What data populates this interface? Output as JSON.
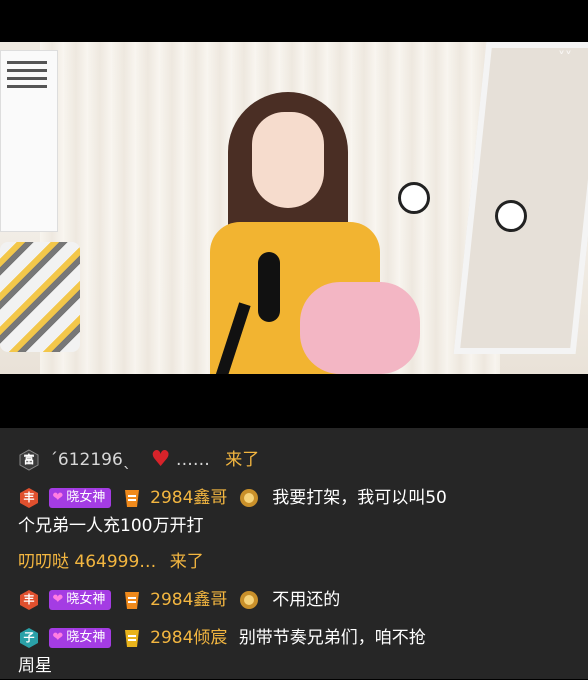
{
  "stream": {
    "collapse_label": "˅˅"
  },
  "chat": {
    "messages": [
      {
        "type": "arrival",
        "level_badge": "富",
        "user": "´612196ˎ",
        "user_suffix": "……",
        "arrive_text": "来了"
      },
      {
        "type": "chat",
        "level_badge": "丰",
        "guard_label": "晓女神",
        "fan_name": "2984鑫哥",
        "line1": "我要打架，我可以叫50",
        "line2": "个兄弟一人充100万开打"
      },
      {
        "type": "arrival",
        "user": "叨叨哒 464999…",
        "arrive_text": "来了"
      },
      {
        "type": "chat",
        "level_badge": "丰",
        "guard_label": "晓女神",
        "fan_name": "2984鑫哥",
        "line1": "不用还的"
      },
      {
        "type": "chat",
        "level_badge": "子",
        "guard_label": "晓女神",
        "fan_name": "2984倾宸",
        "line1": "别带节奏兄弟们，咱不抢",
        "line2": "周星"
      }
    ]
  },
  "colors": {
    "guard_pill": "#a43ce3",
    "fan_gold": "#f3b640",
    "chat_bg": "#262626",
    "level_red": "#e0502e",
    "level_teal": "#2aa1a8"
  }
}
